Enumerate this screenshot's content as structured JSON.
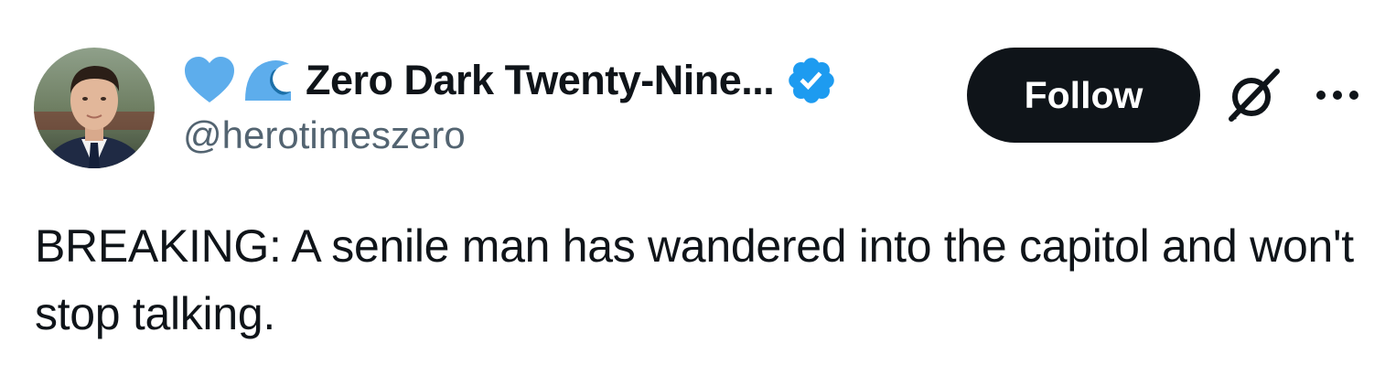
{
  "author": {
    "display_name": "Zero Dark Twenty-Nine...",
    "handle": "@herotimeszero",
    "name_emojis": [
      "blue-heart-emoji",
      "water-wave-emoji"
    ],
    "verified": true
  },
  "actions": {
    "follow_label": "Follow",
    "grok_icon": "grok-icon",
    "more_icon": "more-options-icon"
  },
  "tweet": {
    "text": "BREAKING: A senile man has wandered into the capitol and won't stop talking."
  },
  "colors": {
    "text_primary": "#0f1419",
    "text_secondary": "#536471",
    "verified_blue": "#1d9bf0",
    "follow_bg": "#0f1419",
    "heart_blue": "#5dadec"
  }
}
